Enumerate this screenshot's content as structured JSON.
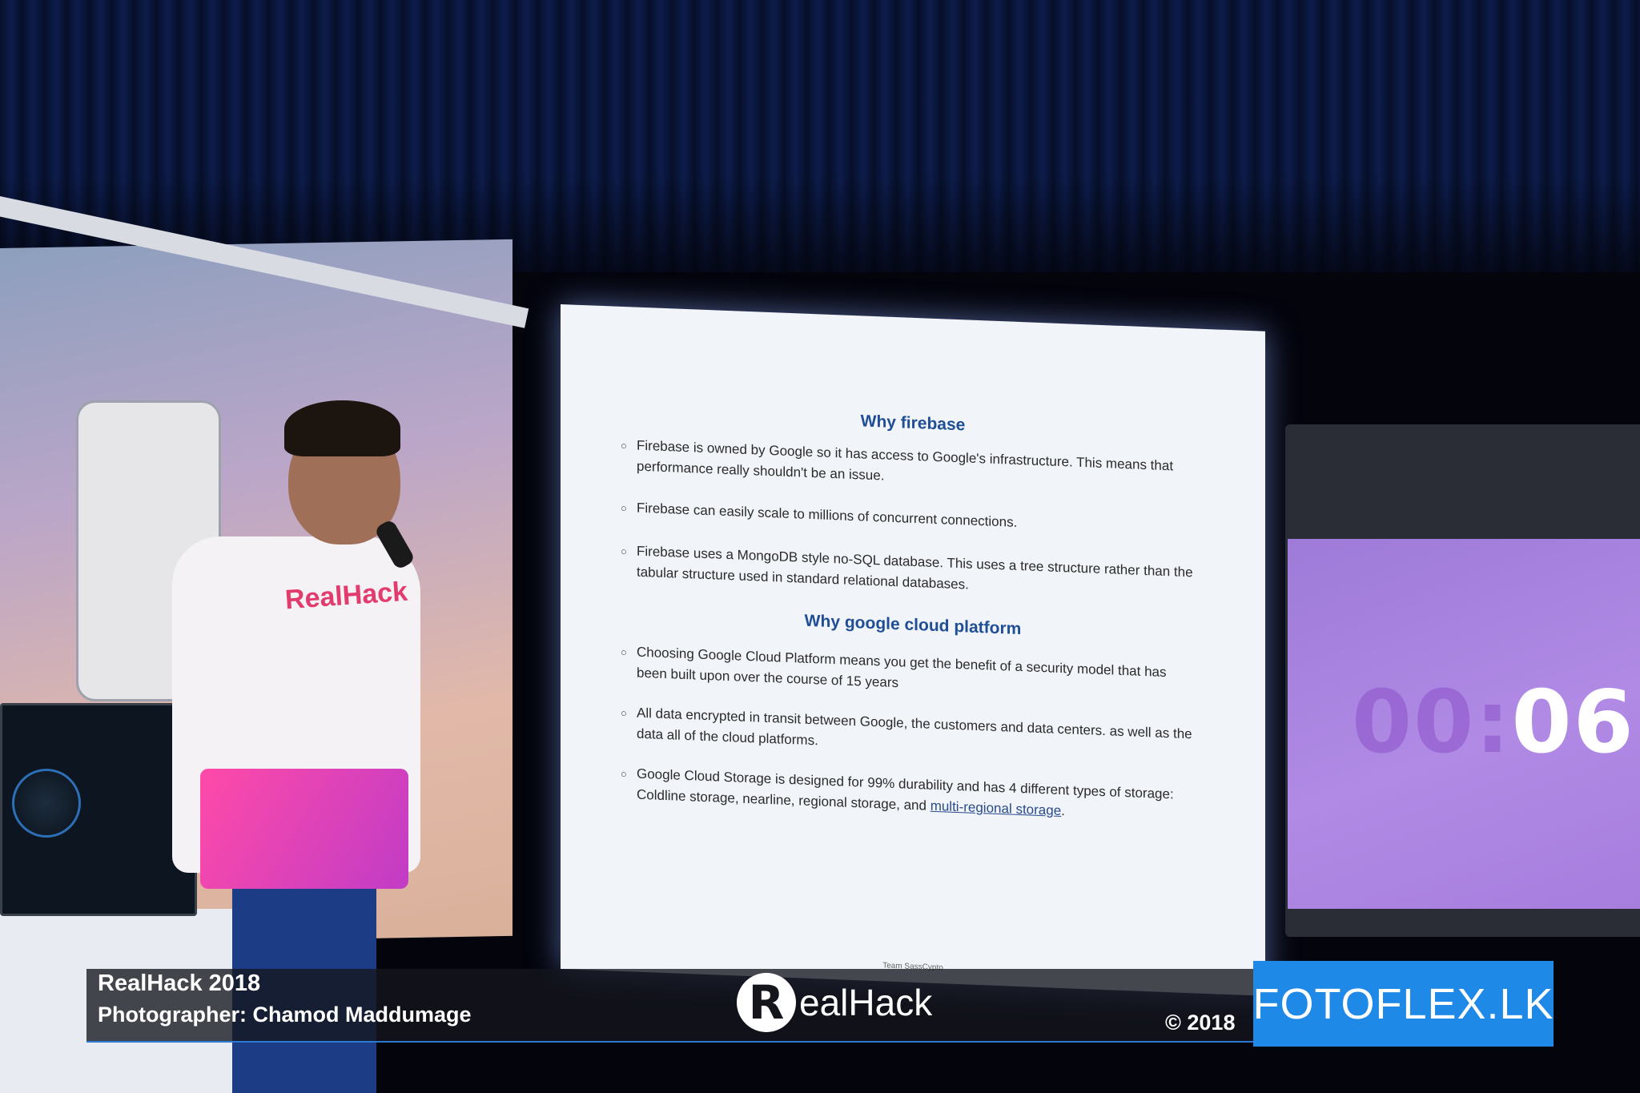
{
  "slide": {
    "heading1": "Why firebase",
    "bullets1": [
      "Firebase is owned by Google so it has access to Google's infrastructure. This means that performance really shouldn't be an issue.",
      "Firebase can easily scale to millions of concurrent connections.",
      "Firebase uses a MongoDB style no-SQL database. This uses a tree structure rather than the tabular structure used in standard relational databases."
    ],
    "heading2": "Why google cloud platform",
    "bullets2": [
      "Choosing Google Cloud Platform means you get the benefit of a security model that has been built upon over the course of 15 years",
      "All data encrypted in transit between Google, the customers and data centers. as well as the data all of the cloud platforms."
    ],
    "bullet_last_prefix": "Google Cloud Storage is designed for 99% durability and has 4 different types of storage: Coldline storage, nearline, regional storage, and ",
    "bullet_last_link": "multi-regional storage",
    "bullet_last_suffix": ".",
    "footer": "Team SassCypto"
  },
  "timer": {
    "dim": "00:",
    "bright": "06:"
  },
  "shirt_logo": "RealHack",
  "watermark": {
    "title": "RealHack 2018",
    "photographer": "Photographer: Chamod Maddumage",
    "logo_r": "R",
    "logo_text": "ealHack",
    "copyright": "© 2018",
    "brand": "FOTOFLEX.LK"
  },
  "colors": {
    "slide_heading": "#1f4e96",
    "timer_purple": "#b08ae5",
    "brand_blue": "#1e89e6"
  }
}
